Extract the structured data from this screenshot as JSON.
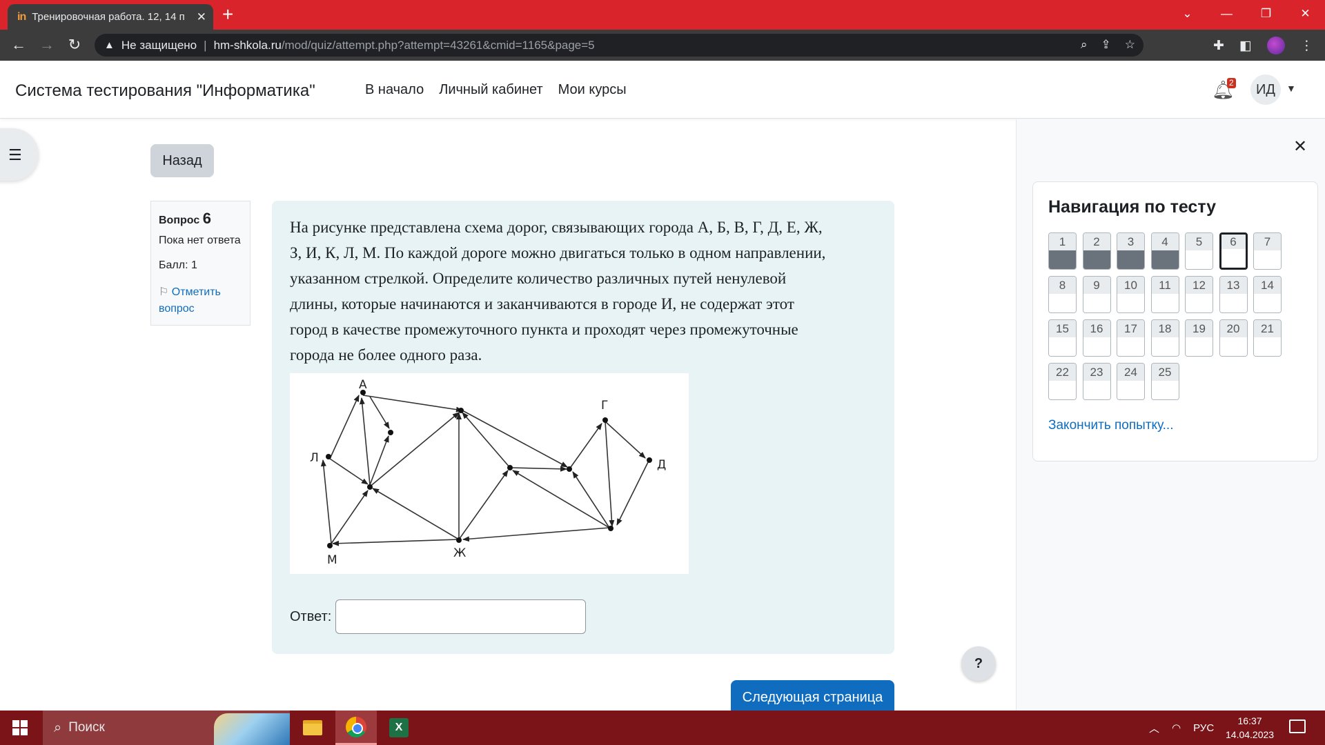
{
  "browser": {
    "tab_title": "Тренировочная работа. 12, 14 п",
    "tab_favicon": "in",
    "insecure_label": "Не защищено",
    "url_host": "hm-shkola.ru",
    "url_path": "/mod/quiz/attempt.php?attempt=43261&cmid=1165&page=5"
  },
  "header": {
    "site_name": "Система тестирования \"Информатика\"",
    "nav": [
      "В начало",
      "Личный кабинет",
      "Мои курсы"
    ],
    "notification_count": "2",
    "user_initials": "ИД"
  },
  "back_button": "Назад",
  "question_info": {
    "label": "Вопрос",
    "number": "6",
    "state": "Пока нет ответа",
    "grade": "Балл: 1",
    "flag_line1": "Отметить",
    "flag_line2": "вопрос"
  },
  "question": {
    "text_lines": [
      "На рисунке представлена схема дорог, связывающих города А, Б, В, Г, Д, Е, Ж,",
      "З, И, К, Л, М. По каждой дороге можно двигаться только в одном направлении,",
      "указанном стрелкой. Определите количество различных путей ненулевой",
      "длины, которые начинаются и заканчиваются в городе И, не содержат этот",
      "город в качестве промежуточного пункта и проходят через промежуточные",
      "города не более одного раза."
    ],
    "graph_labels": {
      "A": "А",
      "G": "Г",
      "L": "Л",
      "D": "Д",
      "M": "М",
      "Zh": "Ж"
    },
    "answer_label": "Ответ:",
    "answer_value": ""
  },
  "next_button": "Следующая страница",
  "help_button": "?",
  "quiz_nav": {
    "title": "Навигация по тесту",
    "buttons": [
      {
        "n": "1",
        "state": "answered"
      },
      {
        "n": "2",
        "state": "answered"
      },
      {
        "n": "3",
        "state": "answered"
      },
      {
        "n": "4",
        "state": "answered"
      },
      {
        "n": "5",
        "state": "notyet"
      },
      {
        "n": "6",
        "state": "current"
      },
      {
        "n": "7",
        "state": "notyet"
      },
      {
        "n": "8",
        "state": "notyet"
      },
      {
        "n": "9",
        "state": "notyet"
      },
      {
        "n": "10",
        "state": "notyet"
      },
      {
        "n": "11",
        "state": "notyet"
      },
      {
        "n": "12",
        "state": "notyet"
      },
      {
        "n": "13",
        "state": "notyet"
      },
      {
        "n": "14",
        "state": "notyet"
      },
      {
        "n": "15",
        "state": "notyet"
      },
      {
        "n": "16",
        "state": "notyet"
      },
      {
        "n": "17",
        "state": "notyet"
      },
      {
        "n": "18",
        "state": "notyet"
      },
      {
        "n": "19",
        "state": "notyet"
      },
      {
        "n": "20",
        "state": "notyet"
      },
      {
        "n": "21",
        "state": "notyet"
      },
      {
        "n": "22",
        "state": "notyet"
      },
      {
        "n": "23",
        "state": "notyet"
      },
      {
        "n": "24",
        "state": "notyet"
      },
      {
        "n": "25",
        "state": "notyet"
      }
    ],
    "finish_link": "Закончить попытку..."
  },
  "taskbar": {
    "search_placeholder": "Поиск",
    "language": "РУС",
    "time": "16:37",
    "date": "14.04.2023"
  }
}
